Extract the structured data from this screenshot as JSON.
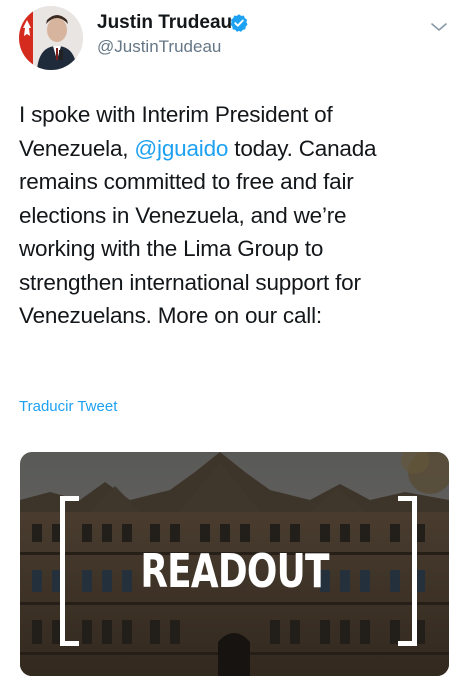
{
  "author": {
    "name": "Justin Trudeau",
    "handle": "@JustinTrudeau",
    "verified_icon": "verified-badge-icon",
    "avatar_icon": "profile-avatar"
  },
  "tweet": {
    "lines": [
      "I spoke with Interim President of",
      [
        "Venezuela, ",
        "@jguaido",
        " today. Canada"
      ],
      "remains committed to free and fair",
      "elections in Venezuela, and we’re",
      "working with the Lima Group to",
      "strengthen international support for",
      "Venezuelans. More on our call:"
    ],
    "mention": "@jguaido",
    "translate_label": "Traducir Tweet"
  },
  "card": {
    "overlay_text": "READOUT"
  },
  "colors": {
    "link": "#1da1f2",
    "secondary_text": "#657786",
    "primary_text": "#14171a"
  }
}
